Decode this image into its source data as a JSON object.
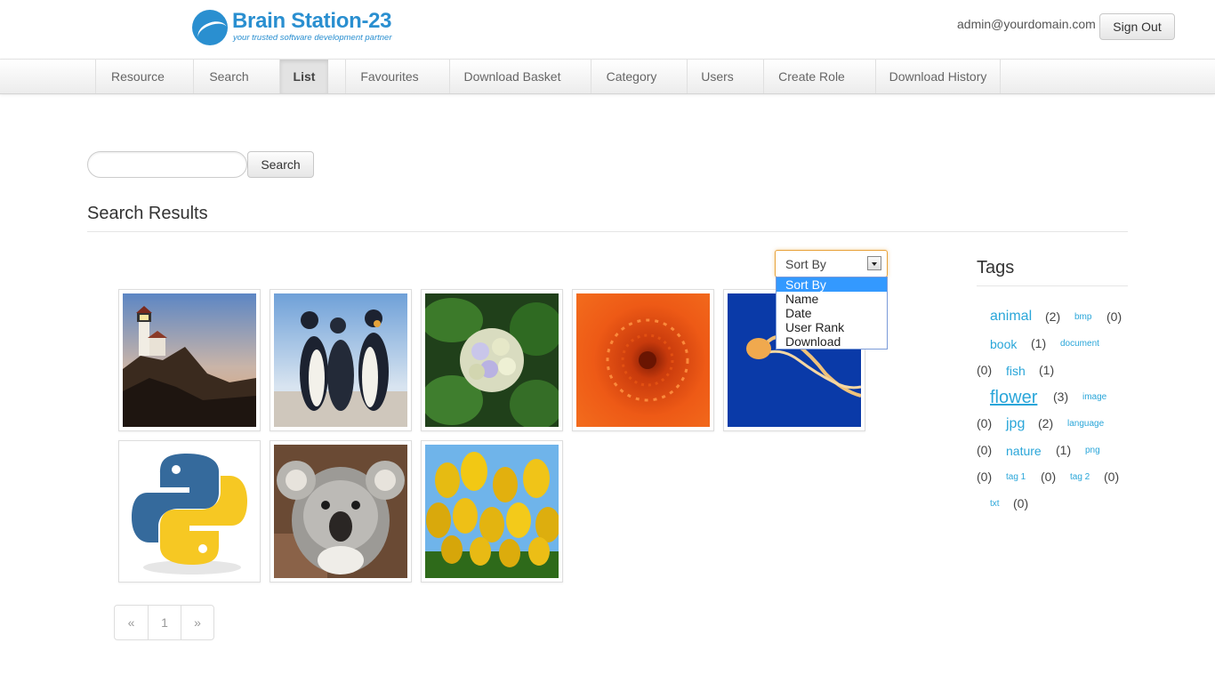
{
  "brand": {
    "name": "Brain Station-23",
    "tagline": "your trusted software development partner",
    "color": "#2a8fd0"
  },
  "user": {
    "email": "admin@yourdomain.com",
    "sign_out_label": "Sign Out"
  },
  "nav": {
    "items": [
      {
        "label": "Resource"
      },
      {
        "label": "Search"
      },
      {
        "label": "List",
        "active": true
      },
      {
        "label": "Favourites"
      },
      {
        "label": "Download Basket"
      },
      {
        "label": "Category"
      },
      {
        "label": "Users"
      },
      {
        "label": "Create Role"
      },
      {
        "label": "Download History"
      }
    ]
  },
  "search": {
    "value": "",
    "button_label": "Search"
  },
  "results": {
    "title": "Search Results",
    "thumbnails": [
      {
        "subject": "lighthouse"
      },
      {
        "subject": "penguins"
      },
      {
        "subject": "hydrangea"
      },
      {
        "subject": "chrysanthemum"
      },
      {
        "subject": "jellyfish"
      },
      {
        "subject": "python-logo"
      },
      {
        "subject": "koala"
      },
      {
        "subject": "tulips"
      }
    ]
  },
  "sort": {
    "selected": "Sort By",
    "options": [
      "Sort By",
      "Name",
      "Date",
      "User Rank",
      "Download"
    ],
    "accent": "#3399ff"
  },
  "tags": {
    "title": "Tags",
    "link_color": "#2aa6d9",
    "items": [
      {
        "name": "animal",
        "count": "(2)"
      },
      {
        "name": "bmp",
        "count": "(0)"
      },
      {
        "name": "book",
        "count": "(1)"
      },
      {
        "name": "document",
        "count": "(0)"
      },
      {
        "name": "fish",
        "count": "(1)"
      },
      {
        "name": "flower",
        "count": "(3)"
      },
      {
        "name": "image",
        "count": "(0)"
      },
      {
        "name": "jpg",
        "count": "(2)"
      },
      {
        "name": "language",
        "count": "(0)"
      },
      {
        "name": "nature",
        "count": "(1)"
      },
      {
        "name": "png",
        "count": "(0)"
      },
      {
        "name": "tag 1",
        "count": "(0)"
      },
      {
        "name": "tag 2",
        "count": "(0)"
      },
      {
        "name": "txt",
        "count": "(0)"
      }
    ]
  },
  "pagination": {
    "prev": "«",
    "pages": [
      "1"
    ],
    "next": "»"
  }
}
